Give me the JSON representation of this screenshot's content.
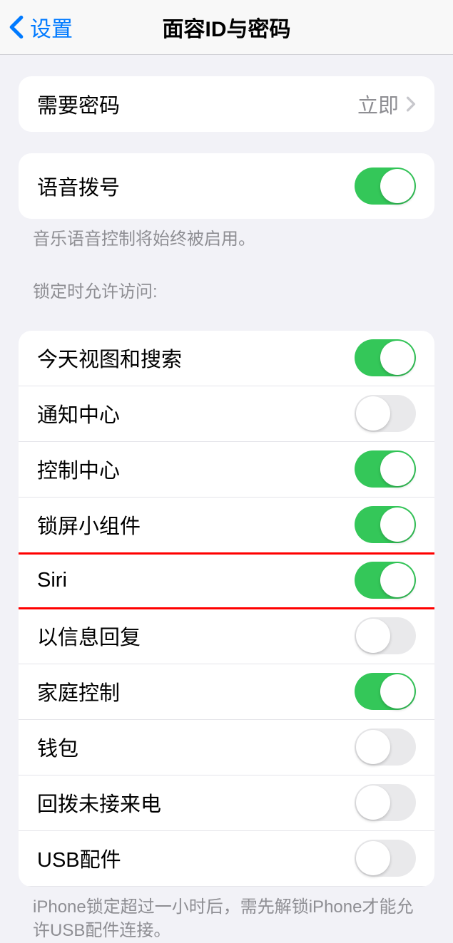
{
  "header": {
    "back_label": "设置",
    "title": "面容ID与密码"
  },
  "passcode_group": {
    "require_passcode": {
      "label": "需要密码",
      "value": "立即"
    }
  },
  "voice_dial": {
    "label": "语音拨号",
    "on": true,
    "footer": "音乐语音控制将始终被启用。"
  },
  "lock_access": {
    "header": "锁定时允许访问:",
    "items": [
      {
        "label": "今天视图和搜索",
        "on": true
      },
      {
        "label": "通知中心",
        "on": false
      },
      {
        "label": "控制中心",
        "on": true
      },
      {
        "label": "锁屏小组件",
        "on": true
      },
      {
        "label": "Siri",
        "on": true
      },
      {
        "label": "以信息回复",
        "on": false
      },
      {
        "label": "家庭控制",
        "on": true
      },
      {
        "label": "钱包",
        "on": false
      },
      {
        "label": "回拨未接来电",
        "on": false
      },
      {
        "label": "USB配件",
        "on": false
      }
    ],
    "footer": "iPhone锁定超过一小时后，需先解锁iPhone才能允许USB配件连接。"
  }
}
